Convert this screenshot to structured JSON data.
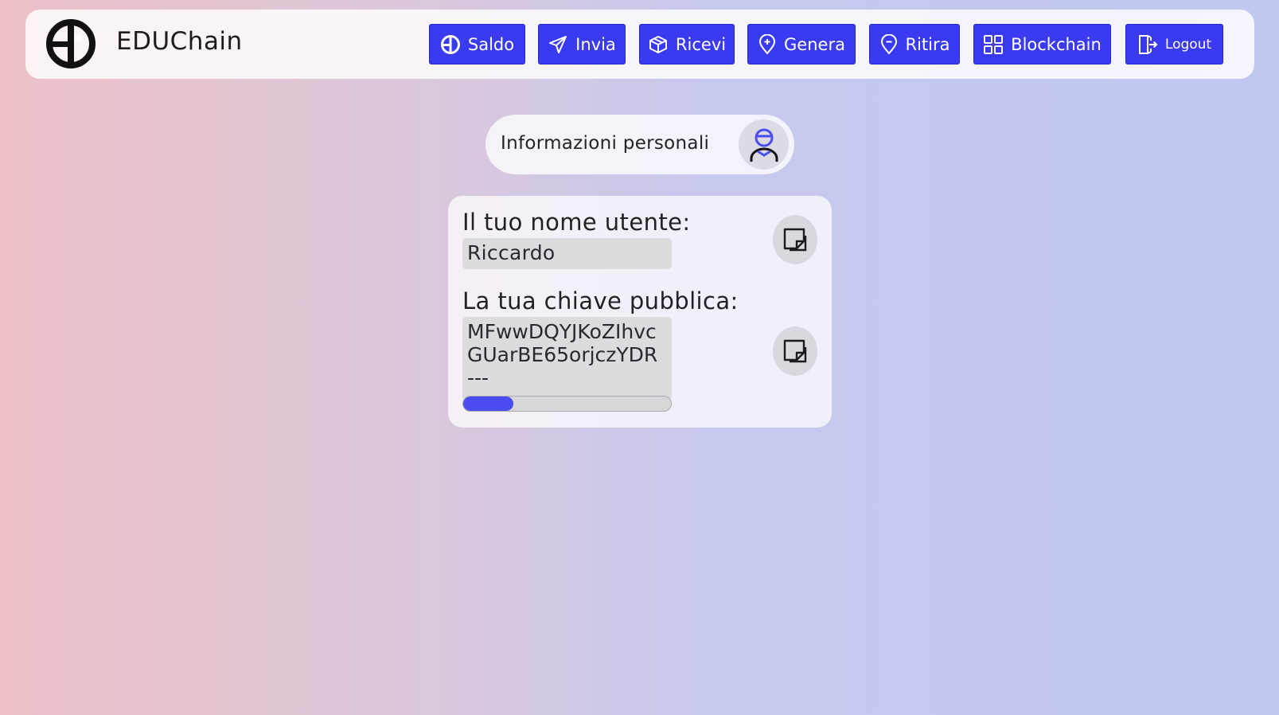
{
  "header": {
    "brand": "EDUChain",
    "nav": [
      {
        "label": "Saldo",
        "icon": "balance-coin-icon"
      },
      {
        "label": "Invia",
        "icon": "send-plane-icon"
      },
      {
        "label": "Ricevi",
        "icon": "receive-box-icon"
      },
      {
        "label": "Genera",
        "icon": "generate-pin-icon"
      },
      {
        "label": "Ritira",
        "icon": "withdraw-pin-icon"
      },
      {
        "label": "Blockchain",
        "icon": "grid-icon"
      },
      {
        "label": "Logout",
        "icon": "logout-door-icon"
      }
    ]
  },
  "info_section": {
    "label": "Informazioni personali",
    "icon": "user-avatar-icon"
  },
  "card": {
    "username_label": "Il tuo nome utente:",
    "username_value": "Riccardo",
    "publickey_label": "La tua chiave pubblica:",
    "publickey_lines": [
      "MFwwDQYJKoZIhvc",
      "GUarBE65orjczYDR",
      "---"
    ],
    "publickey_scroll_fraction": 0.24
  },
  "colors": {
    "accent": "#3a3af2",
    "avatar_icon": "#4b4bf2"
  }
}
